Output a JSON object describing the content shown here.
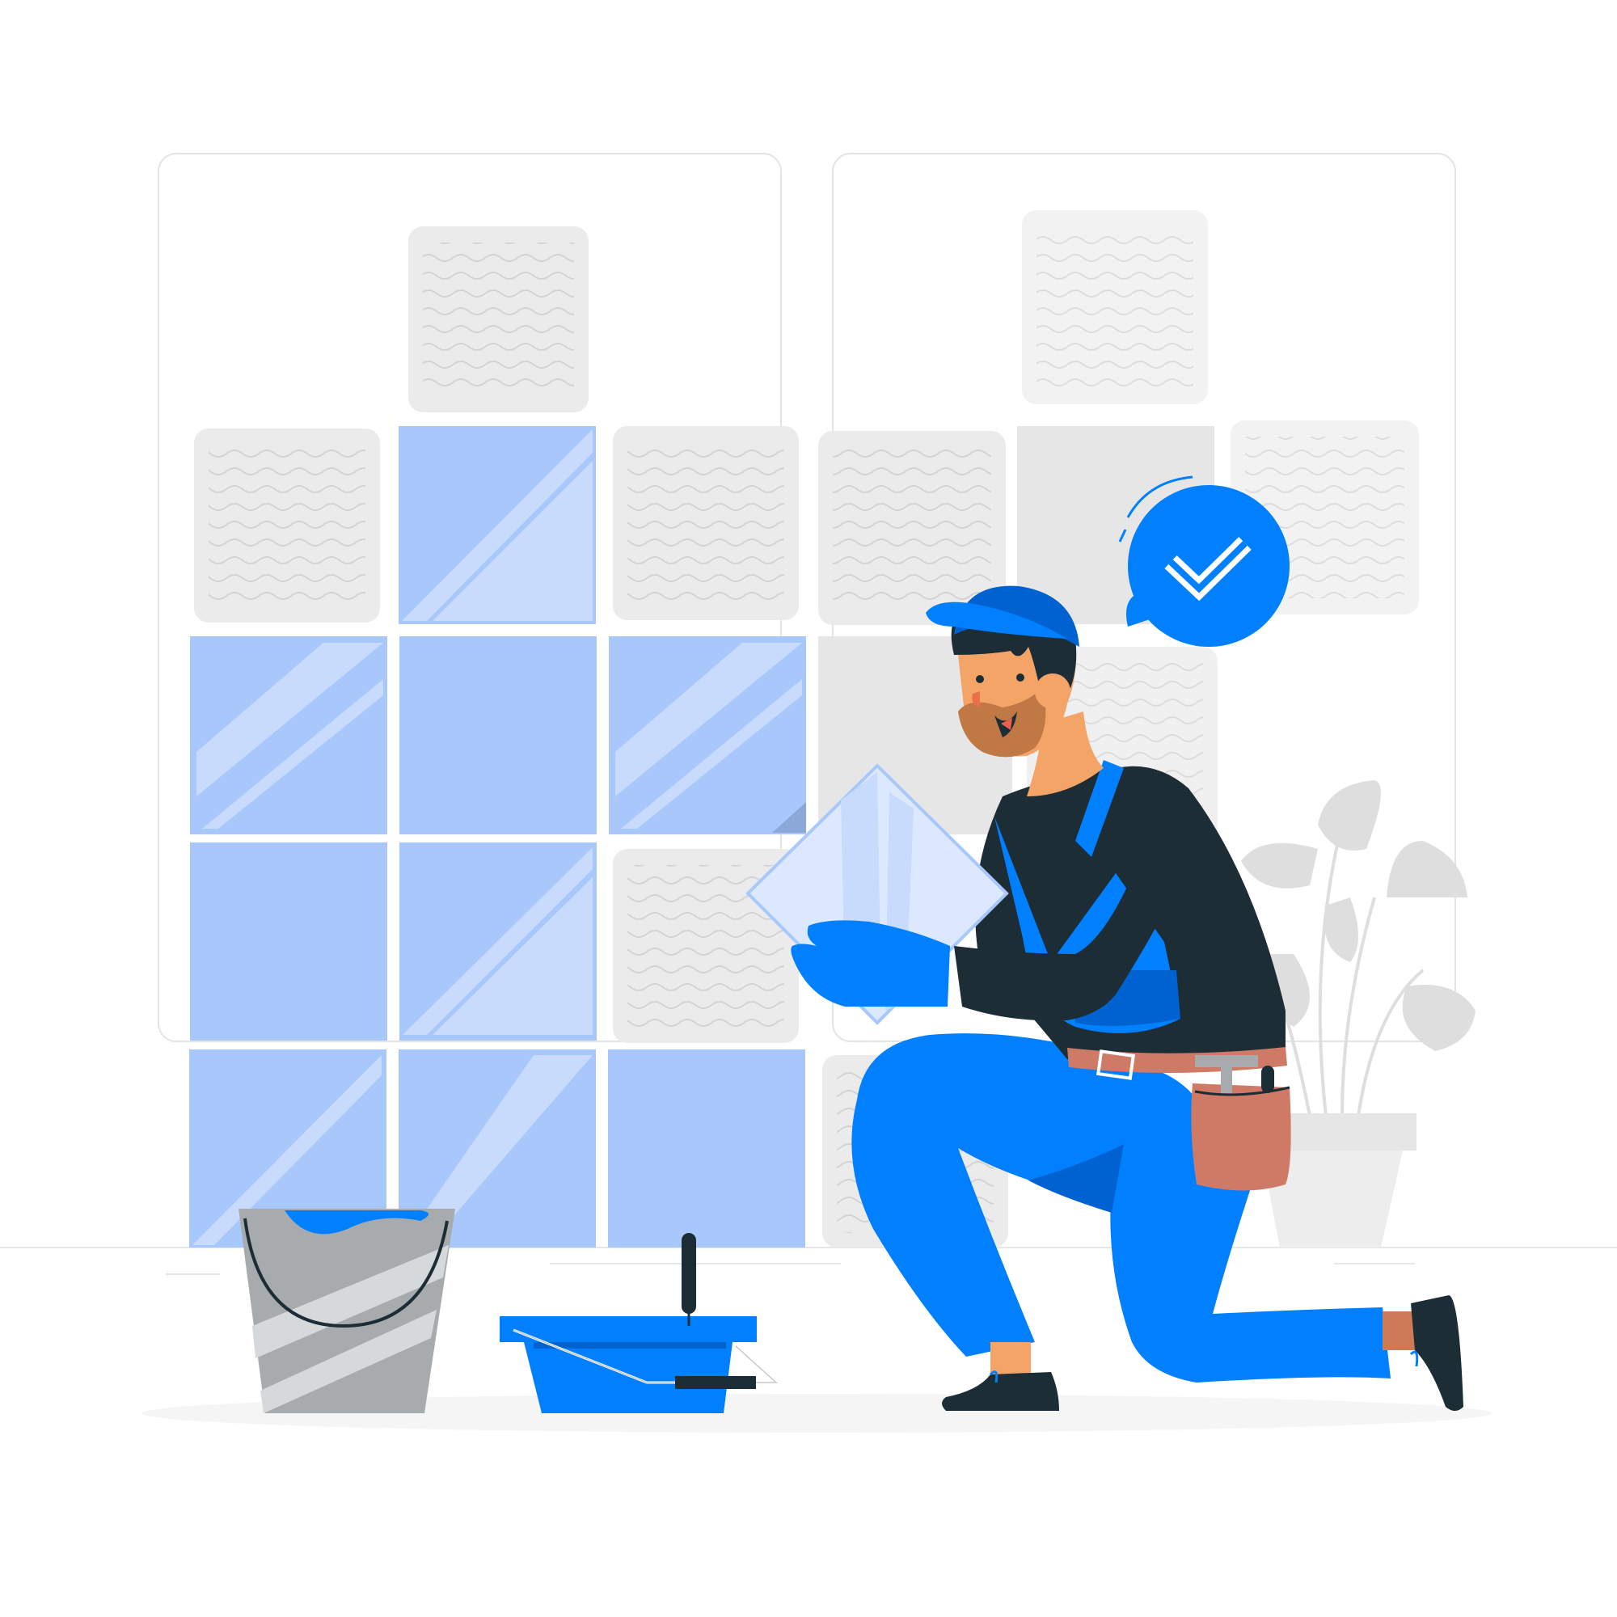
{
  "illustration": {
    "subject": "tiler",
    "palette": {
      "primary": "#0080FF",
      "primary_dark": "#0062D1",
      "tile_blue": "#A8C8FC",
      "tile_highlight": "#C8DBFC",
      "tile_gray": "#EBEBEB",
      "panel_border": "#E0E0E0",
      "shirt": "#1D2D35",
      "skin": "#F5A468",
      "beard": "#C07945",
      "belt": "#CE7A66",
      "bucket": "#A7ABAD",
      "plant": "#DEDEDE"
    },
    "icons": {
      "badge": "check-icon"
    }
  }
}
